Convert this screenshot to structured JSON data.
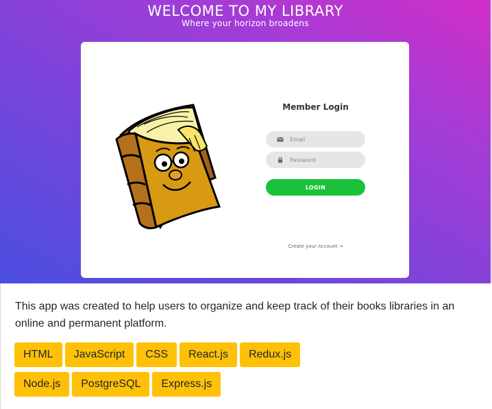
{
  "hero": {
    "title": "WELCOME TO MY LIBRARY",
    "subtitle": "Where your horizon broadens"
  },
  "login": {
    "title": "Member Login",
    "email_placeholder": "Email",
    "password_placeholder": "Password",
    "login_label": "LOGIN",
    "create_account_label": "Create your Account →",
    "mascot": "cartoon-book-character-with-glasses"
  },
  "description": "This app was created to help users to organize and keep track of their books libraries in an online and permanent platform.",
  "tech_tags": {
    "row1": [
      "HTML",
      "JavaScript",
      "CSS",
      "React.js",
      "Redux.js"
    ],
    "row2": [
      "Node.js",
      "PostgreSQL",
      "Express.js"
    ]
  },
  "colors": {
    "gradient_start": "#4a4ee0",
    "gradient_end": "#d22ec8",
    "login_button": "#19c23a",
    "tag_background": "#ffc107"
  }
}
